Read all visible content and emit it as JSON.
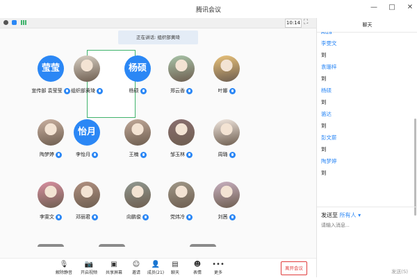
{
  "window": {
    "title": "腾讯会议",
    "min": "—",
    "max": "□",
    "close": "✕"
  },
  "infobar": {
    "time": "10:14",
    "fullscreen": "⛶"
  },
  "speaking": "正在讲话: 组织部黄琦",
  "participants": [
    {
      "name": "宣传部 袁莹莹",
      "avatar_text": "莹莹",
      "avatar_color": "#2b87f5"
    },
    {
      "name": "组织部黄琦",
      "avatar_text": "",
      "avatar_color": "#d8d0c4"
    },
    {
      "name": "杨硕",
      "avatar_text": "杨硕",
      "avatar_color": "#2b87f5"
    },
    {
      "name": "郑云香",
      "avatar_text": "",
      "avatar_color": "#a8c4a8"
    },
    {
      "name": "叶娜",
      "avatar_text": "",
      "avatar_color": "#e9c27a"
    },
    {
      "name": "陶梦婷",
      "avatar_text": "",
      "avatar_color": "#c9b0a0"
    },
    {
      "name": "李怡月",
      "avatar_text": "怡月",
      "avatar_color": "#2b87f5"
    },
    {
      "name": "王楠",
      "avatar_text": "",
      "avatar_color": "#c0a898"
    },
    {
      "name": "邹玉林",
      "avatar_text": "",
      "avatar_color": "#8a6f6f"
    },
    {
      "name": "周璐",
      "avatar_text": "",
      "avatar_color": "#f2e8e0"
    },
    {
      "name": "李雯文",
      "avatar_text": "",
      "avatar_color": "#d88fa0"
    },
    {
      "name": "邓丽君",
      "avatar_text": "",
      "avatar_color": "#b09080"
    },
    {
      "name": "向鹏俊",
      "avatar_text": "",
      "avatar_color": "#909890"
    },
    {
      "name": "党炜冷",
      "avatar_text": "",
      "avatar_color": "#a09888"
    },
    {
      "name": "刘茜",
      "avatar_text": "",
      "avatar_color": "#c8b0c0"
    }
  ],
  "toolbar": {
    "unmute": "解除静音",
    "video": "开启视频",
    "share": "共享屏幕",
    "invite": "邀请",
    "members": "成员(21)",
    "chat": "聊天",
    "reaction": "表情",
    "more": "更多",
    "leave": "离开会议"
  },
  "chat": {
    "title": "聊天",
    "messages": [
      {
        "name": "Aiza",
        "text": ""
      },
      {
        "name": "李雯文",
        "text": "到"
      },
      {
        "name": "袁珊梓",
        "text": "到"
      },
      {
        "name": "杨硕",
        "text": "到"
      },
      {
        "name": "骆达",
        "text": "到"
      },
      {
        "name": "彭文薪",
        "text": "到"
      },
      {
        "name": "陶梦婷",
        "text": "到"
      }
    ],
    "send_to_label": "发送至",
    "send_to_target": "所有人",
    "input_placeholder": "请输入消息...",
    "send_label": "发送(S)"
  },
  "colors": {
    "accent": "#2b87f5",
    "speaker_border": "#3fb36b",
    "leave_red": "#e03c3c"
  },
  "icons": {
    "info": "info-icon",
    "shield": "shield-icon",
    "signal": "signal-icon",
    "mic_muted": "mic-muted-icon",
    "video_off": "video-off-icon",
    "share": "share-screen-icon",
    "invite": "invite-icon",
    "members": "members-icon",
    "chat": "chat-icon",
    "emoji": "emoji-icon",
    "more": "more-icon"
  }
}
